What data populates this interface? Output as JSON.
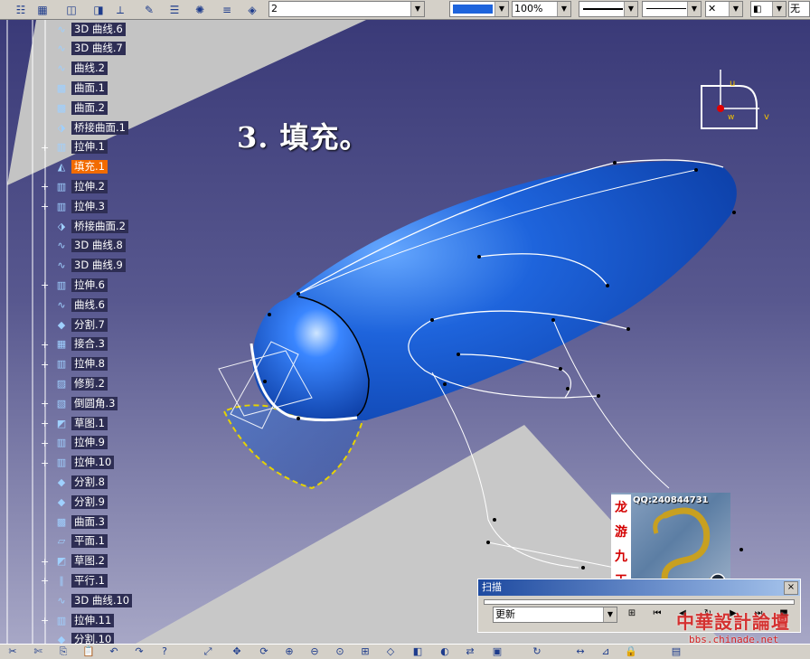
{
  "toolbar": {
    "layer_value": "2",
    "zoom_value": "100%",
    "right_cut_label": "无",
    "accent_color": "#1e64dc",
    "icons": [
      "tree-icon",
      "grid-icon",
      "cube-stack-icon",
      "cube-icon",
      "axis-icon",
      "pencil-icon",
      "align-icon",
      "lightbulb-icon",
      "list-icon",
      "layers-icon"
    ]
  },
  "tree": {
    "items": [
      {
        "label": "3D 曲线.6",
        "icon": "curve-icon"
      },
      {
        "label": "3D 曲线.7",
        "icon": "curve-icon"
      },
      {
        "label": "曲线.2",
        "icon": "curve-icon"
      },
      {
        "label": "曲面.1",
        "icon": "surface-icon"
      },
      {
        "label": "曲面.2",
        "icon": "surface-icon"
      },
      {
        "label": "桥接曲面.1",
        "icon": "blend-icon"
      },
      {
        "label": "拉伸.1",
        "icon": "extrude-icon"
      },
      {
        "label": "填充.1",
        "icon": "fill-icon"
      },
      {
        "label": "拉伸.2",
        "icon": "extrude-icon"
      },
      {
        "label": "拉伸.3",
        "icon": "extrude-icon"
      },
      {
        "label": "桥接曲面.2",
        "icon": "blend-icon"
      },
      {
        "label": "3D 曲线.8",
        "icon": "curve-icon"
      },
      {
        "label": "3D 曲线.9",
        "icon": "curve-icon"
      },
      {
        "label": "拉伸.6",
        "icon": "extrude-icon"
      },
      {
        "label": "曲线.6",
        "icon": "curve-icon"
      },
      {
        "label": "分割.7",
        "icon": "split-icon"
      },
      {
        "label": "接合.3",
        "icon": "join-icon"
      },
      {
        "label": "拉伸.8",
        "icon": "extrude-icon"
      },
      {
        "label": "修剪.2",
        "icon": "trim-icon"
      },
      {
        "label": "倒圆角.3",
        "icon": "fillet-icon"
      },
      {
        "label": "草图.1",
        "icon": "sketch-icon"
      },
      {
        "label": "拉伸.9",
        "icon": "extrude-icon"
      },
      {
        "label": "拉伸.10",
        "icon": "extrude-icon"
      },
      {
        "label": "分割.8",
        "icon": "split-icon"
      },
      {
        "label": "分割.9",
        "icon": "split-icon"
      },
      {
        "label": "曲面.3",
        "icon": "surface-icon"
      },
      {
        "label": "平面.1",
        "icon": "plane-icon"
      },
      {
        "label": "草图.2",
        "icon": "sketch-icon"
      },
      {
        "label": "平行.1",
        "icon": "parallel-icon"
      },
      {
        "label": "3D 曲线.10",
        "icon": "curve-icon"
      },
      {
        "label": "拉伸.11",
        "icon": "extrude-icon"
      },
      {
        "label": "分割.10",
        "icon": "split-icon"
      }
    ],
    "selected_label": "填充.1"
  },
  "viewport": {
    "caption": "3. 填充。",
    "compass": {
      "u": "u",
      "v": "v",
      "w": "w"
    },
    "model_color": "#1e64dc",
    "plane_color": "#c8c8c8"
  },
  "badge": {
    "qq": "QQ:240844731",
    "strip_chars": [
      "龙",
      "游",
      "九",
      "天"
    ]
  },
  "scan_panel": {
    "title": "扫描",
    "close": "×",
    "mode": "更新"
  },
  "watermark": {
    "line1": "中華設計論壇",
    "line2": "bbs.chinade.net"
  }
}
